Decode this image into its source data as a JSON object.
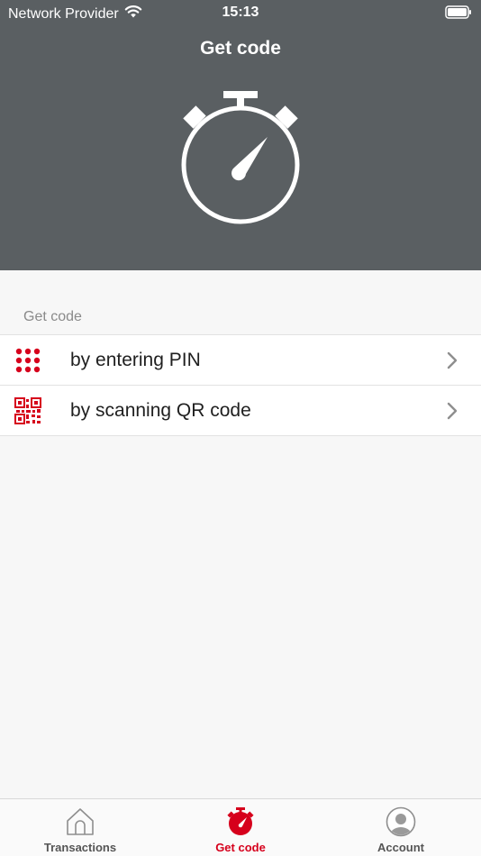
{
  "status_bar": {
    "carrier": "Network Provider",
    "time": "15:13"
  },
  "header": {
    "title": "Get code"
  },
  "section": {
    "label": "Get code",
    "items": [
      {
        "label": "by entering PIN",
        "icon": "keypad-icon"
      },
      {
        "label": "by scanning QR code",
        "icon": "qr-code-icon"
      }
    ]
  },
  "tabbar": {
    "tabs": [
      {
        "label": "Transactions",
        "icon": "home-icon",
        "active": false
      },
      {
        "label": "Get code",
        "icon": "stopwatch-icon",
        "active": true
      },
      {
        "label": "Account",
        "icon": "user-icon",
        "active": false
      }
    ]
  },
  "colors": {
    "header_bg": "#5a5f62",
    "accent": "#d6001c",
    "background": "#f7f7f7"
  }
}
